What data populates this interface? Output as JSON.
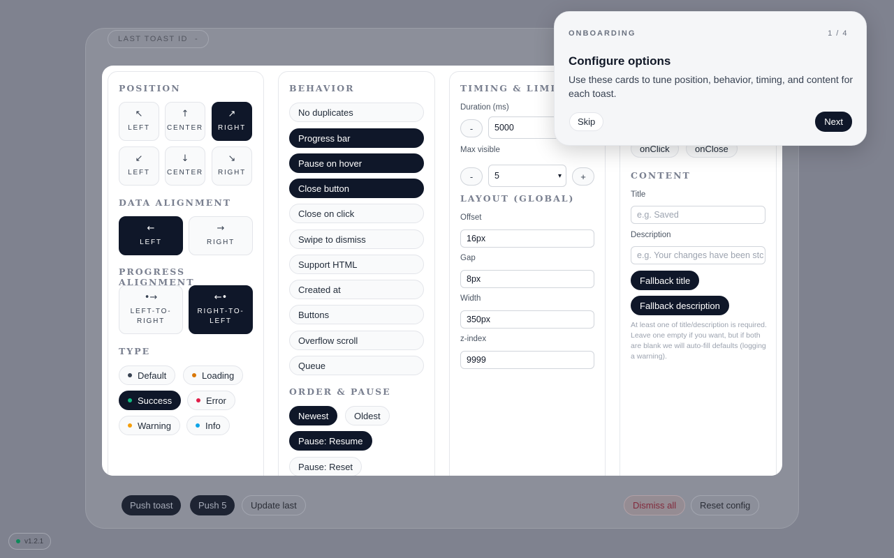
{
  "background": {
    "last_toast_label": "LAST TOAST ID",
    "last_toast_value": "-",
    "actions": {
      "push_toast": "Push toast",
      "push_5": "Push 5",
      "update_last": "Update last",
      "dismiss_all": "Dismiss all",
      "reset_config": "Reset config"
    },
    "version": "v1.2.1"
  },
  "position": {
    "title": "POSITION",
    "tiles": [
      {
        "icon": "↖",
        "label": "LEFT",
        "active": false
      },
      {
        "icon": "↑",
        "label": "CENTER",
        "active": false
      },
      {
        "icon": "↗",
        "label": "RIGHT",
        "active": true
      },
      {
        "icon": "↙",
        "label": "LEFT",
        "active": false
      },
      {
        "icon": "↓",
        "label": "CENTER",
        "active": false
      },
      {
        "icon": "↘",
        "label": "RIGHT",
        "active": false
      }
    ]
  },
  "data_alignment": {
    "title": "DATA ALIGNMENT",
    "options": [
      {
        "icon": "←",
        "label": "LEFT",
        "active": true
      },
      {
        "icon": "→",
        "label": "RIGHT",
        "active": false
      }
    ]
  },
  "progress_alignment": {
    "title": "PROGRESS ALIGNMENT",
    "options": [
      {
        "icon": "•→",
        "line1": "LEFT-TO-",
        "line2": "RIGHT",
        "active": false
      },
      {
        "icon": "←•",
        "line1": "RIGHT-TO-",
        "line2": "LEFT",
        "active": true
      }
    ]
  },
  "type": {
    "title": "TYPE",
    "options": [
      {
        "label": "Default",
        "color": "#374151",
        "active": false
      },
      {
        "label": "Loading",
        "color": "#d97706",
        "active": false
      },
      {
        "label": "Success",
        "color": "#10b981",
        "active": true
      },
      {
        "label": "Error",
        "color": "#e11d48",
        "active": false
      },
      {
        "label": "Warning",
        "color": "#f59e0b",
        "active": false
      },
      {
        "label": "Info",
        "color": "#0ea5e9",
        "active": false
      }
    ]
  },
  "behavior": {
    "title": "BEHAVIOR",
    "items": [
      {
        "label": "No duplicates",
        "active": false
      },
      {
        "label": "Progress bar",
        "active": true
      },
      {
        "label": "Pause on hover",
        "active": true
      },
      {
        "label": "Close button",
        "active": true
      },
      {
        "label": "Close on click",
        "active": false
      },
      {
        "label": "Swipe to dismiss",
        "active": false
      },
      {
        "label": "Support HTML",
        "active": false
      },
      {
        "label": "Created at",
        "active": false
      },
      {
        "label": "Buttons",
        "active": false
      },
      {
        "label": "Overflow scroll",
        "active": false
      },
      {
        "label": "Queue",
        "active": false
      }
    ]
  },
  "order_pause": {
    "title": "ORDER & PAUSE",
    "order": [
      {
        "label": "Newest",
        "active": true
      },
      {
        "label": "Oldest",
        "active": false
      }
    ],
    "pause": [
      {
        "label": "Pause: Resume",
        "active": true
      },
      {
        "label": "Pause: Reset",
        "active": false
      }
    ]
  },
  "timing": {
    "title": "TIMING & LIMITS",
    "duration_label": "Duration (ms)",
    "duration_value": "5000",
    "max_visible_label": "Max visible",
    "max_visible_value": "5",
    "minus": "-",
    "plus": "+"
  },
  "layout": {
    "title": "LAYOUT (GLOBAL)",
    "fields": [
      {
        "label": "Offset",
        "value": "16px"
      },
      {
        "label": "Gap",
        "value": "8px"
      },
      {
        "label": "Width",
        "value": "350px"
      },
      {
        "label": "z-index",
        "value": "9999"
      }
    ]
  },
  "callbacks": {
    "items": [
      "onClick",
      "onClose"
    ]
  },
  "content": {
    "title": "CONTENT",
    "title_label": "Title",
    "title_placeholder": "e.g. Saved",
    "description_label": "Description",
    "description_placeholder": "e.g. Your changes have been stc",
    "fallback_title": "Fallback title",
    "fallback_description": "Fallback description",
    "note": "At least one of title/description is required. Leave one empty if you want, but if both are blank we will auto-fill defaults (logging a warning)."
  },
  "onboarding": {
    "eyebrow": "ONBOARDING",
    "step": "1 / 4",
    "title": "Configure options",
    "body": "Use these cards to tune position, behavior, timing, and content for each toast.",
    "skip": "Skip",
    "next": "Next"
  }
}
